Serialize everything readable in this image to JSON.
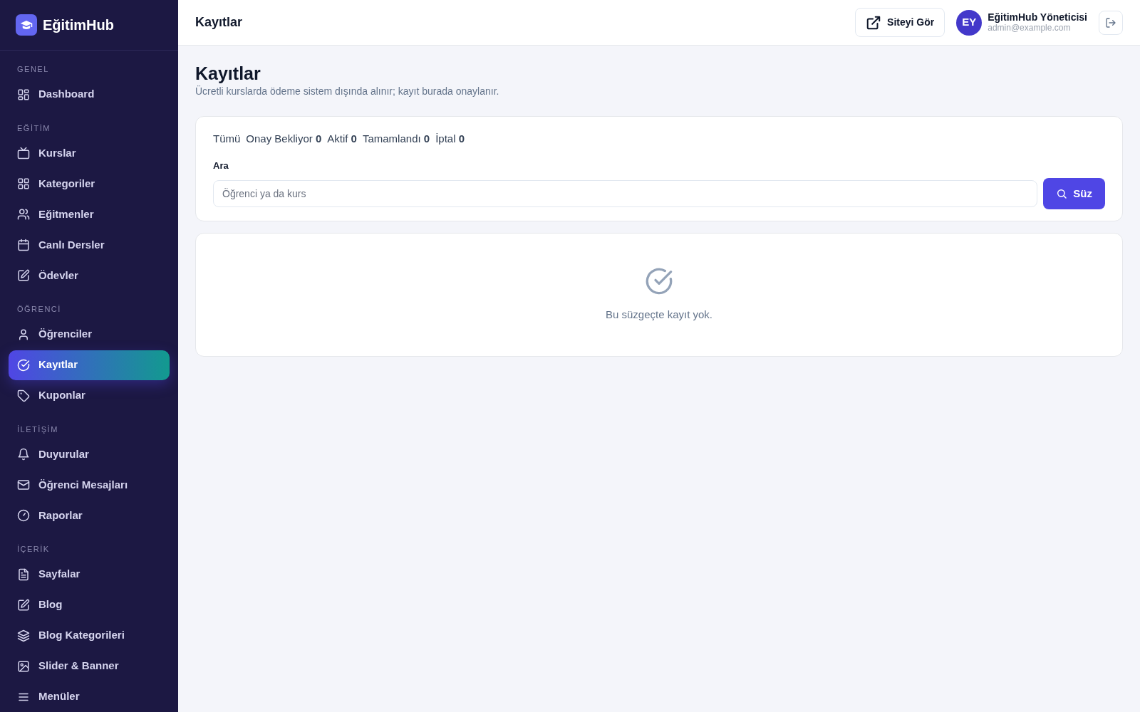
{
  "brand": {
    "name": "EğitimHub"
  },
  "sidebar": {
    "sections": [
      {
        "label": "GENEL",
        "items": [
          {
            "label": "Dashboard",
            "selected": false
          }
        ]
      },
      {
        "label": "EĞİTİM",
        "items": [
          {
            "label": "Kurslar",
            "selected": false
          },
          {
            "label": "Kategoriler",
            "selected": false
          },
          {
            "label": "Eğitmenler",
            "selected": false
          },
          {
            "label": "Canlı Dersler",
            "selected": false
          },
          {
            "label": "Ödevler",
            "selected": false
          }
        ]
      },
      {
        "label": "ÖĞRENCİ",
        "items": [
          {
            "label": "Öğrenciler",
            "selected": false
          },
          {
            "label": "Kayıtlar",
            "selected": true
          },
          {
            "label": "Kuponlar",
            "selected": false
          }
        ]
      },
      {
        "label": "İLETİŞİM",
        "items": [
          {
            "label": "Duyurular",
            "selected": false
          },
          {
            "label": "Öğrenci Mesajları",
            "selected": false
          },
          {
            "label": "Raporlar",
            "selected": false
          }
        ]
      },
      {
        "label": "İÇERİK",
        "items": [
          {
            "label": "Sayfalar",
            "selected": false
          },
          {
            "label": "Blog",
            "selected": false
          },
          {
            "label": "Blog Kategorileri",
            "selected": false
          },
          {
            "label": "Slider & Banner",
            "selected": false
          },
          {
            "label": "Menüler",
            "selected": false
          }
        ]
      }
    ]
  },
  "header": {
    "title": "Kayıtlar",
    "view_site": "Siteyi Gör",
    "user": {
      "initials": "EY",
      "name": "EğitimHub Yöneticisi",
      "email": "admin@example.com"
    }
  },
  "page": {
    "title": "Kayıtlar",
    "subtitle": "Ücretli kurslarda ödeme sistem dışında alınır; kayıt burada onaylanır."
  },
  "filters": [
    {
      "label": "Tümü"
    },
    {
      "label": "Onay Bekliyor",
      "count": "0"
    },
    {
      "label": "Aktif",
      "count": "0"
    },
    {
      "label": "Tamamlandı",
      "count": "0"
    },
    {
      "label": "İptal",
      "count": "0"
    }
  ],
  "search": {
    "label": "Ara",
    "placeholder": "Öğrenci ya da kurs",
    "button": "Süz"
  },
  "empty_state": {
    "message": "Bu süzgeçte kayıt yok."
  }
}
